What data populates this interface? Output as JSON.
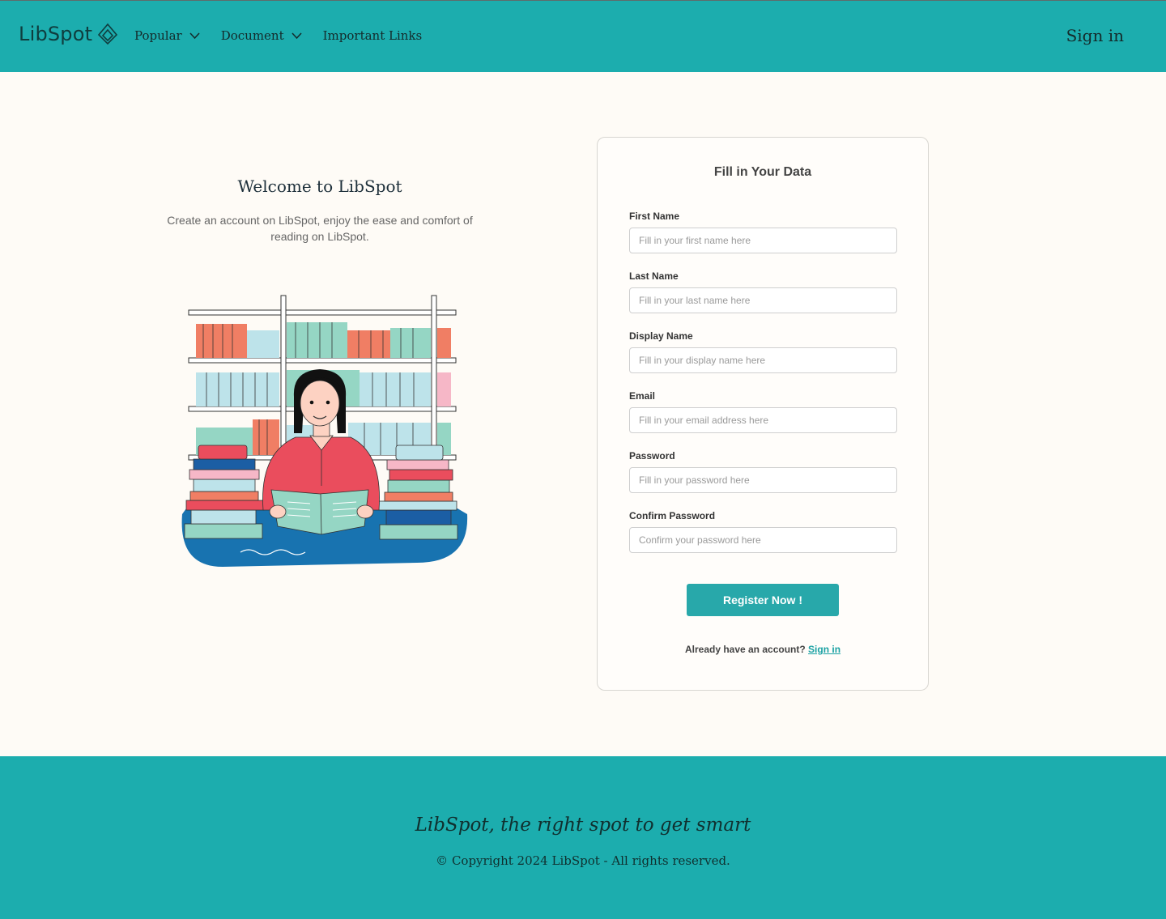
{
  "header": {
    "logo_text": "LibSpot",
    "nav": [
      {
        "label": "Popular",
        "has_dropdown": true
      },
      {
        "label": "Document",
        "has_dropdown": true
      },
      {
        "label": "Important Links",
        "has_dropdown": false
      }
    ],
    "signin": "Sign in"
  },
  "welcome": {
    "title": "Welcome to LibSpot",
    "subtitle": "Create an account on LibSpot, enjoy the ease and comfort of reading on LibSpot."
  },
  "form": {
    "title": "Fill in Your Data",
    "fields": [
      {
        "label": "First Name",
        "placeholder": "Fill in your first name here",
        "value": ""
      },
      {
        "label": "Last Name",
        "placeholder": "Fill in your last name here",
        "value": ""
      },
      {
        "label": "Display Name",
        "placeholder": "Fill in your display name here",
        "value": ""
      },
      {
        "label": "Email",
        "placeholder": "Fill in your email address here",
        "value": ""
      },
      {
        "label": "Password",
        "placeholder": "Fill in your password here",
        "value": ""
      },
      {
        "label": "Confirm Password",
        "placeholder": "Confirm your password here",
        "value": ""
      }
    ],
    "submit": "Register Now !",
    "already_text": "Already have an account?",
    "signin_link": "Sign in"
  },
  "footer": {
    "tagline": "LibSpot, the right spot to get smart",
    "copyright": "© Copyright 2024 LibSpot - All rights reserved."
  },
  "colors": {
    "primary": "#1cadae",
    "button": "#28a8aa",
    "background": "#fefbf6"
  },
  "icons": [
    "logo-drop-icon",
    "chevron-down-icon"
  ]
}
